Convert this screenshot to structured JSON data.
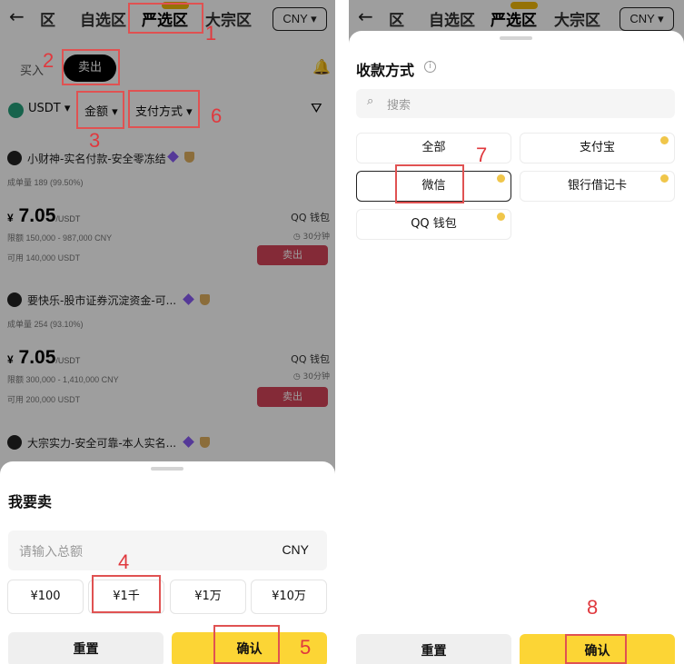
{
  "left": {
    "header": {
      "tabs": [
        {
          "label": "区"
        },
        {
          "label": "自选区"
        },
        {
          "label": "严选区"
        },
        {
          "label": "大宗区"
        }
      ],
      "currency": "CNY"
    },
    "segment": {
      "buy": "买入",
      "sell": "卖出"
    },
    "filters": {
      "coin": "USDT",
      "amount": "金额",
      "payment": "支付方式"
    },
    "listings": [
      {
        "name": "小财神-实名付款-安全零冻结",
        "stats": "成单量 189 (99.50%)",
        "price": "7.05",
        "unit": "/USDT",
        "limit_label": "限额",
        "limit": "150,000 - 987,000 CNY",
        "avail_label": "可用",
        "available": "140,000 USDT",
        "method": "QQ 钱包",
        "time": "30分钟",
        "action": "卖出"
      },
      {
        "name": "要快乐-股市证券沉淀资金-可...",
        "stats": "成单量 254 (93.10%)",
        "price": "7.05",
        "unit": "/USDT",
        "limit_label": "限额",
        "limit": "300,000 - 1,410,000 CNY",
        "avail_label": "可用",
        "available": "200,000 USDT",
        "method": "QQ 钱包",
        "time": "30分钟",
        "action": "卖出"
      },
      {
        "name": "大宗实力-安全可靠-本人实名..."
      }
    ],
    "currency_symbol": "¥",
    "sheet": {
      "title": "我要卖",
      "input_placeholder": "请输入总额",
      "input_currency": "CNY",
      "chips": [
        "¥100",
        "¥1千",
        "¥1万",
        "¥10万"
      ],
      "reset": "重置",
      "confirm": "确认"
    }
  },
  "right": {
    "header": {
      "tabs": [
        {
          "label": "区"
        },
        {
          "label": "自选区"
        },
        {
          "label": "严选区"
        },
        {
          "label": "大宗区"
        }
      ],
      "currency": "CNY"
    },
    "sheet": {
      "title": "收款方式",
      "search_placeholder": "搜索",
      "methods": [
        "全部",
        "支付宝",
        "微信",
        "银行借记卡",
        "QQ 钱包"
      ],
      "reset": "重置",
      "confirm": "确认"
    }
  },
  "annotations": [
    "1",
    "2",
    "3",
    "4",
    "5",
    "6",
    "7",
    "8"
  ],
  "colors": {
    "accent": "#fcd535",
    "sell": "#d6455a",
    "annotation": "#e05252"
  }
}
